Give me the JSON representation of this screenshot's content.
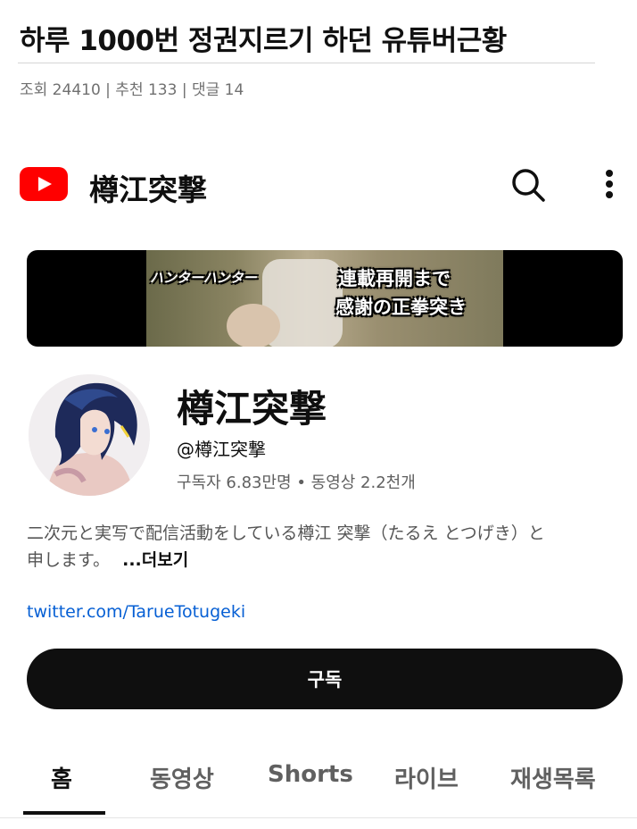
{
  "post": {
    "title": "하루 1000번 정권지르기 하던 유튜버근황",
    "meta": "조회 24410 | 추천 133 | 댓글 14"
  },
  "app_bar": {
    "channel_name": "樽江突撃",
    "icons": [
      "youtube-logo",
      "search-icon",
      "more-vert-icon"
    ]
  },
  "banner": {
    "caption_left": "ハンターハンター",
    "caption_right_line1": "連載再開まで",
    "caption_right_line2": "感謝の正拳突き"
  },
  "channel": {
    "name": "樽江突撃",
    "handle": "@樽江突撃",
    "stats": "구독자 6.83만명 • 동영상 2.2천개",
    "description_line1": "二次元と実写で配信活動をしている樽江 突撃（たるえ とつげき）と",
    "description_line2": "申します。",
    "more_label": "...더보기",
    "link": "twitter.com/TarueTotugeki",
    "subscribe_label": "구독"
  },
  "tabs": [
    {
      "label": "홈",
      "active": true
    },
    {
      "label": "동영상",
      "active": false
    },
    {
      "label": "Shorts",
      "active": false
    },
    {
      "label": "라이브",
      "active": false
    },
    {
      "label": "재생목록",
      "active": false
    }
  ],
  "colors": {
    "youtube_red": "#ff0000",
    "subscribe_bg": "#0f0f0f",
    "link": "#065fd4"
  }
}
